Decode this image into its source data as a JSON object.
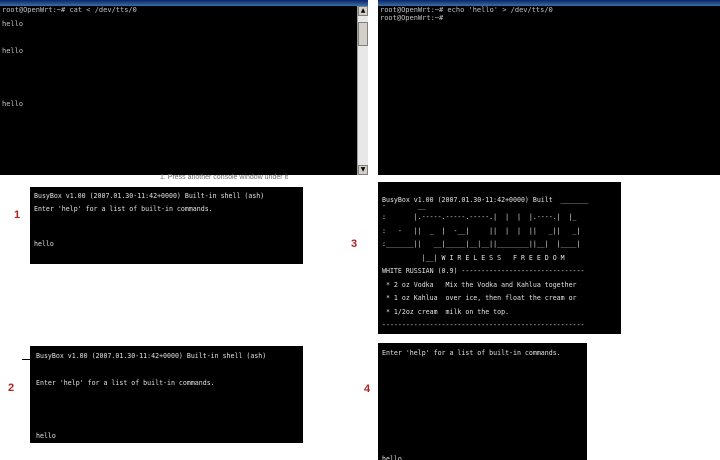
{
  "top_windows": {
    "left": {
      "title": "",
      "lines": [
        "root@OpenWrt:~# cat < /dev/tts/0",
        "",
        "hello",
        "",
        "",
        "hello",
        "",
        "",
        "",
        "",
        "hello"
      ],
      "scroll_up": "▲",
      "scroll_down": "▼"
    },
    "right": {
      "title": "",
      "lines": [
        "root@OpenWrt:~# echo 'hello' > /dev/tts/0",
        "root@OpenWrt:~#"
      ]
    },
    "caption": "1. Press another console window under it"
  },
  "panels": {
    "p1": {
      "number": "1",
      "lines": [
        "BusyBox v1.00 (2007.01.30-11:42+0000) Built-in shell (ash)",
        "Enter 'help' for a list of built-in commands.",
        "",
        "hello"
      ]
    },
    "p2": {
      "number": "2",
      "lines": [
        "BusyBox v1.00 (2007.01.30-11:42+0000) Built-in shell (ash)",
        "Enter 'help' for a list of built-in commands.",
        "hello"
      ]
    },
    "p3": {
      "number": "3",
      "lines": [
        "BusyBox v1.00 (2007.01.30-11:42+0000) Built  _______",
        "-        __",
        ":       |.-----.-----.-----.|  |  |  |.----.|  |_",
        ":   -   ||  _  |  -__|     ||  |  |  ||   _||   _|",
        ":_______||   __|_____|__|__||________||__|  |____|",
        "          |__| W I R E L E S S   F R E E D O M",
        "WHITE RUSSIAN (0.9) -------------------------------",
        " * 2 oz Vodka   Mix the Vodka and Kahlua together",
        " * 1 oz Kahlua  over ice, then float the cream or",
        " * 1/2oz cream  milk on the top.",
        "---------------------------------------------------"
      ]
    },
    "p4": {
      "number": "4",
      "lines": [
        "Enter 'help' for a list of built-in commands.",
        "hello"
      ]
    }
  },
  "colors": {
    "terminal_bg": "#000000",
    "terminal_text": "#c0c0c0",
    "panel_number": "#b22222",
    "titlebar": "#0a246a"
  }
}
